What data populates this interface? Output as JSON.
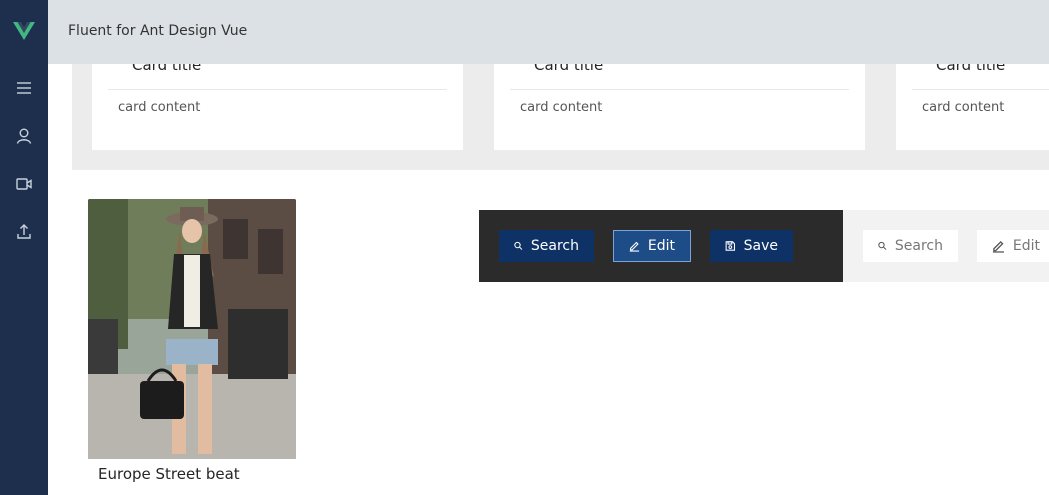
{
  "header": {
    "title": "Fluent for Ant Design Vue"
  },
  "sidebar": {
    "logo": "vue-logo",
    "items": [
      {
        "icon": "menu-icon"
      },
      {
        "icon": "user-icon"
      },
      {
        "icon": "video-icon"
      },
      {
        "icon": "upload-icon"
      }
    ]
  },
  "cards": [
    {
      "title": "Card title",
      "content": "card content"
    },
    {
      "title": "Card title",
      "content": "card content"
    },
    {
      "title": "Card title",
      "content": "card content"
    }
  ],
  "photo_card": {
    "caption": "Europe Street beat"
  },
  "dark_toolbar": {
    "search_label": "Search",
    "edit_label": "Edit",
    "save_label": "Save"
  },
  "light_toolbar": {
    "search_label": "Search",
    "edit_label": "Edit"
  },
  "colors": {
    "sidebar": "#1e2f4d",
    "logo_green": "#41b883",
    "primary_dark": "#0f3266",
    "toolbar_dark": "#2b2b2b"
  }
}
